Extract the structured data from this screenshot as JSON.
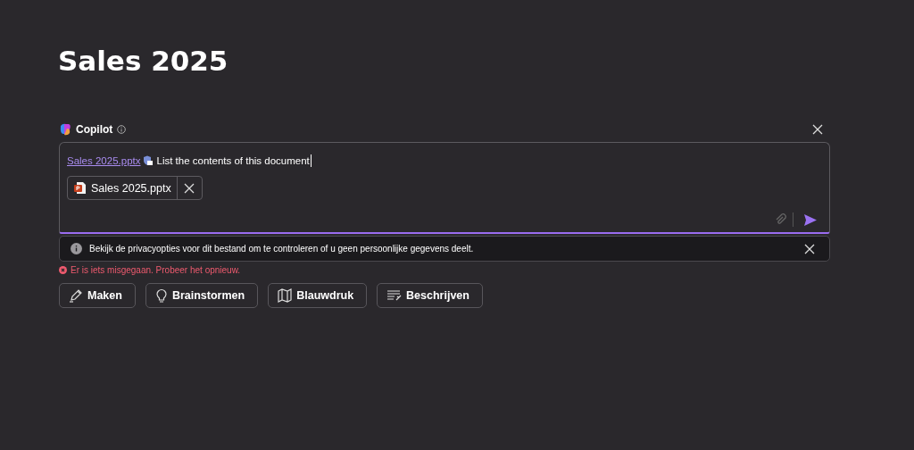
{
  "page_title": "Sales 2025",
  "copilot": {
    "title": "Copilot",
    "composer": {
      "file_link": "Sales 2025.pptx",
      "prompt": "List the contents of this document",
      "attachment": "Sales 2025.pptx"
    },
    "notice": "Bekijk de privacyopties voor dit bestand om te controleren of u geen persoonlijke gegevens deelt.",
    "error": "Er is iets misgegaan. Probeer het opnieuw.",
    "suggestions": [
      "Maken",
      "Brainstormen",
      "Blauwdruk",
      "Beschrijven"
    ]
  }
}
